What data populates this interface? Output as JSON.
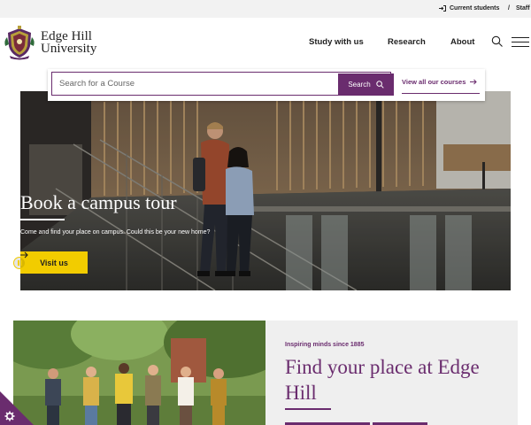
{
  "utility": {
    "current_students": "Current students",
    "separator": "/",
    "staff": "Staff"
  },
  "brand": {
    "line1": "Edge Hill",
    "line2": "University"
  },
  "nav": {
    "items": [
      {
        "label": "Study with us"
      },
      {
        "label": "Research"
      },
      {
        "label": "About"
      }
    ]
  },
  "course_search": {
    "placeholder": "Search for a Course",
    "button_label": "Search",
    "view_all_label": "View all our courses"
  },
  "hero": {
    "title": "Book a campus tour",
    "subtitle": "Come and find your place on campus. Could this be your new home?",
    "cta_label": "Visit us"
  },
  "promo": {
    "eyebrow": "Inspiring minds since 1885",
    "title": "Find your place at Edge Hill"
  },
  "colors": {
    "brand_purple": "#6a2c6e",
    "cta_yellow": "#f2cc00",
    "utility_bar": "#f2f2f2",
    "promo_panel": "#efefef"
  },
  "icons": {
    "login": "login-icon",
    "search": "search-icon",
    "menu": "hamburger-menu-icon",
    "arrow": "arrow-right-icon",
    "pause": "pause-icon",
    "cookie": "cookie-settings-icon"
  }
}
